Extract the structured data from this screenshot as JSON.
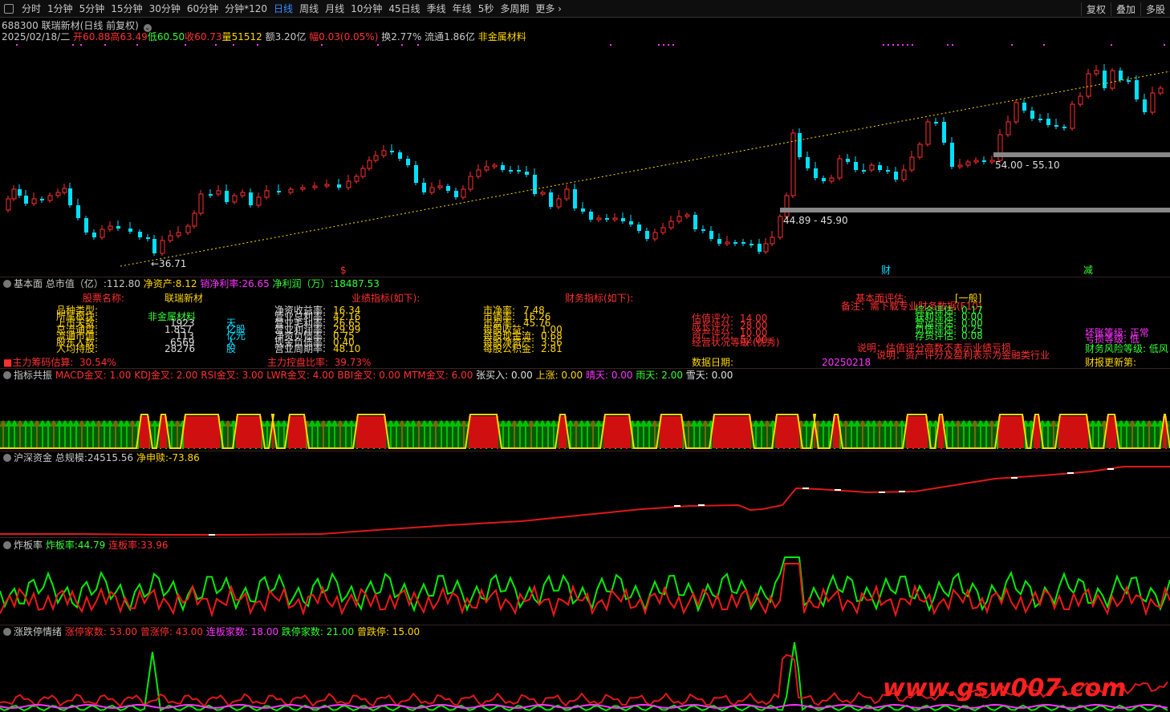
{
  "toolbar": {
    "items": [
      "分时",
      "1分钟",
      "5分钟",
      "15分钟",
      "30分钟",
      "60分钟",
      "分钟*120",
      "日线",
      "周线",
      "月线",
      "10分钟",
      "45日线",
      "季线",
      "年线",
      "5秒",
      "多周期",
      "更多"
    ],
    "active": "日线",
    "right": [
      "复权",
      "叠加",
      "多股"
    ]
  },
  "stock": {
    "code": "688300",
    "name": "联瑞新材",
    "mode": "(日线 前复权)",
    "date": "2025/02/18/二",
    "open_l": "开",
    "open": "60.88",
    "high_l": "高",
    "high": "63.49",
    "low_l": "低",
    "low": "60.50",
    "close_l": "收",
    "close": "60.73",
    "vol_l": "量",
    "vol": "51512",
    "amt_l": "额",
    "amt": "3.20亿",
    "chg_l": "幅",
    "chg": "0.03(0.05%)",
    "turn_l": "换",
    "turn": "2.77%",
    "float_l": "流通",
    "float": "1.86亿",
    "sector": "非金属材料"
  },
  "price_chart": {
    "low_label": "←36.71",
    "zone1": "44.89 - 45.90",
    "zone2": "54.00 - 55.10",
    "marks": [
      "$",
      "财",
      "减"
    ]
  },
  "fundamental": {
    "title": "基本面",
    "cap_l": "总市值（亿）:",
    "cap": "112.80",
    "nav_l": "净资产:",
    "nav": "8.12",
    "margin_l": "销净利率:",
    "margin": "26.65",
    "np_l": "净利润（万）:",
    "np": "18487.53",
    "h_name": "股票名称:",
    "name": "联瑞新材",
    "h_perf": "业绩指标(如下):",
    "h_fin": "财务指标(如下):",
    "h_eval": "基本面评估:",
    "eval": "一般",
    "note": "备注：需下载专业财务数据(F10)",
    "col1": [
      "品种类型:",
      "所属板块:",
      "上市天数:",
      "总流通盘:",
      "流通市值:",
      "股东人数:",
      "人均持股:"
    ],
    "col1v": [
      "非金属材料",
      "1923",
      "1.857",
      "113",
      "6569",
      "28276"
    ],
    "col1u": [
      "天",
      "亿股",
      "亿元",
      "人",
      "股"
    ],
    "chip": "■主力筹码估算:  30.54%",
    "col2": [
      "净资收益率:",
      "营业总利率:",
      "营业毛利率:",
      "营业利润率:",
      "净资负债率:",
      "现金负债率:",
      "营业周期率:"
    ],
    "col2v": [
      "16.34",
      "42.16",
      "26.65",
      "29.99",
      "0.75",
      "0.40",
      "48.10"
    ],
    "ctrl": "主力控盘比率:  39.73%",
    "col3": [
      "市净率:",
      "市销率:",
      "市盈率:",
      "每股收益:",
      "每股现金流:",
      "每股净资产:",
      "每股公积金:"
    ],
    "col3v": [
      "7.48",
      "16.26",
      "45.76",
      "1.00",
      "0.68",
      "3.56",
      "2.81"
    ],
    "col4": [
      "估值评分:",
      "成长评分:",
      "资产评分:",
      "经营状况等级:(优秀)"
    ],
    "col4v": [
      "14.00",
      "28.00",
      "10.00",
      "52.00"
    ],
    "data_date_l": "数据日期:",
    "data_date": "20250218",
    "col5": [
      "综合评估:",
      "获利评估:",
      "营运评估:",
      "负债评估:",
      "存货评估:"
    ],
    "col5v": [
      "0.17",
      "0.00",
      "0.00",
      "0.25",
      "0.08"
    ],
    "desc1": "说明：估值评分高数不表示业绩亏损",
    "desc2": "说明：资产评分及盈利表示为金融类行业",
    "risk_l": "坏账等级:",
    "risk": "正常",
    "risk2_l": "亏损等级:",
    "risk2": "低",
    "risk3_l": "财务风险等级:",
    "risk3": "低风",
    "update_l": "财报更新第:"
  },
  "resonance": {
    "title": "指标共振",
    "items": [
      {
        "l": "MACD金叉:",
        "v": "1.00",
        "c": "#ff3030"
      },
      {
        "l": "KDJ金叉:",
        "v": "2.00",
        "c": "#ff3030"
      },
      {
        "l": "RSI金叉:",
        "v": "3.00",
        "c": "#ff3030"
      },
      {
        "l": "LWR金叉:",
        "v": "4.00",
        "c": "#ff3030"
      },
      {
        "l": "BBI金叉:",
        "v": "0.00",
        "c": "#ff3030"
      },
      {
        "l": "MTM金叉:",
        "v": "6.00",
        "c": "#ff3030"
      },
      {
        "l": "张买入:",
        "v": "0.00",
        "c": "#e0e0e0"
      },
      {
        "l": "上涨:",
        "v": "0.00",
        "c": "#ffd700"
      },
      {
        "l": "晴天:",
        "v": "0.00",
        "c": "#ff33ff"
      },
      {
        "l": "雨天:",
        "v": "2.00",
        "c": "#33ff33"
      },
      {
        "l": "雪天:",
        "v": "0.00",
        "c": "#e0e0e0"
      }
    ]
  },
  "hs": {
    "title": "沪深资金",
    "scale_l": "总规模:",
    "scale": "24515.56",
    "net_l": "净申赎:",
    "net": "-73.86"
  },
  "zb": {
    "title": "炸板率",
    "rate_l": "炸板率:",
    "rate": "44.79",
    "cont_l": "连板率:",
    "cont": "33.96"
  },
  "zd": {
    "title": "涨跌停情绪",
    "items": [
      {
        "l": "涨停家数:",
        "v": "53.00",
        "c": "#ff3030"
      },
      {
        "l": "曾涨停:",
        "v": "43.00",
        "c": "#ff3030"
      },
      {
        "l": "连板家数:",
        "v": "18.00",
        "c": "#ff33ff"
      },
      {
        "l": "跌停家数:",
        "v": "21.00",
        "c": "#33ff33"
      },
      {
        "l": "曾跌停:",
        "v": "15.00",
        "c": "#ffd700"
      }
    ]
  },
  "watermark": "www.gsw007.com",
  "colors": {
    "up": "#ff3030",
    "down": "#00e0ff",
    "green": "#00ff00",
    "yellow": "#ffd700",
    "magenta": "#ff33ff",
    "active": "#3a8bff"
  }
}
